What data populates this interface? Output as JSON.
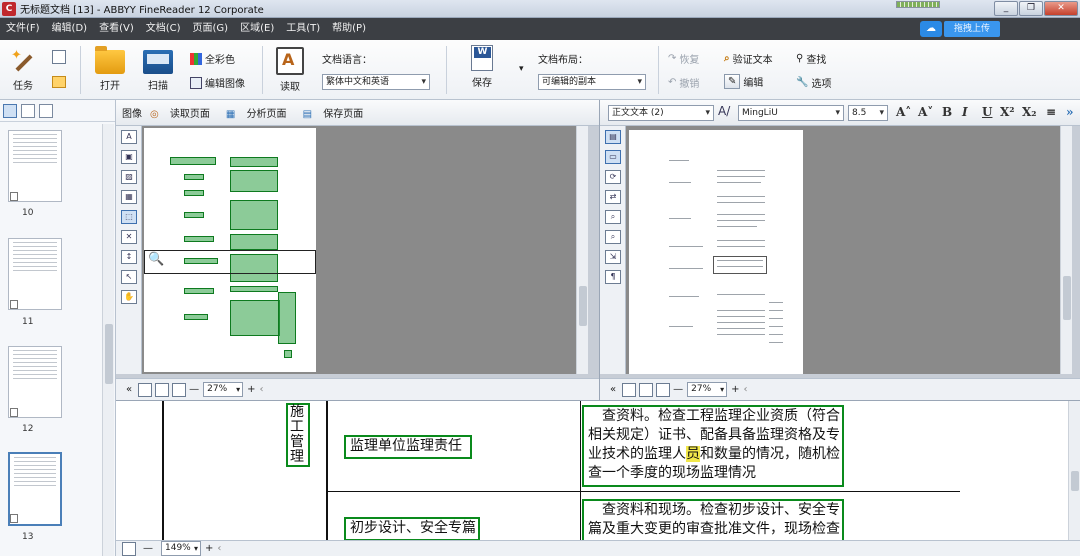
{
  "window": {
    "title": "无标题文档 [13] - ABBYY FineReader 12 Corporate",
    "controls": [
      "_",
      "❐",
      "✕"
    ]
  },
  "menu": {
    "items": [
      "文件(F)",
      "编辑(D)",
      "查看(V)",
      "文档(C)",
      "页面(G)",
      "区域(E)",
      "工具(T)",
      "帮助(P)"
    ],
    "upload_label": "拖拽上传"
  },
  "toolbar": {
    "task_label": "任务",
    "open_label": "打开",
    "scan_label": "扫描",
    "color_label": "全彩色",
    "edit_image_label": "编辑图像",
    "read_label": "读取",
    "doc_language_label": "文档语言：",
    "doc_language_value": "繁体中文和英语",
    "save_label": "保存",
    "doc_layout_label": "文档布局：",
    "doc_layout_value": "可编辑的副本",
    "redo_label": "恢复",
    "undo_label": "撤销",
    "verify_label": "验证文本",
    "find_label": "查找",
    "edit_label": "编辑",
    "options_label": "选项"
  },
  "thumbnails": {
    "pages": [
      "10",
      "11",
      "12",
      "13"
    ],
    "selected": "13"
  },
  "image_pane": {
    "title": "图像",
    "read_page": "读取页面",
    "analyze_page": "分析页面",
    "save_page": "保存页面",
    "zoom": "27%"
  },
  "text_pane": {
    "style_value": "正文文本 (2)",
    "font_value": "MingLiU",
    "size_value": "8.5",
    "format_buttons": [
      "A˄",
      "A˅",
      "B",
      "I",
      "U",
      "X²",
      "X₂",
      "≡",
      "»"
    ],
    "zoom": "27%"
  },
  "zoom_pane": {
    "vertical_label": [
      "施",
      "工",
      "管",
      "理"
    ],
    "row1_cell": "监理单位监理责任",
    "row1_text_a": "查资料。检查工程监理企业资质（符合",
    "row1_text_b": "相关规定）证书、配备具备监理资格及专",
    "row1_text_c_pre": "业技术的监理人",
    "row1_text_c_hl": "员",
    "row1_text_c_post": "和数量的情况，随机检",
    "row1_text_d": "查一个季度的现场监理情况",
    "row2_cell": "初步设计、安全专篇",
    "row2_text_a": "查资料和现场。检查初步设计、安全专",
    "row2_text_b": "篇及重大变更的审查批准文件，现场检查"
  },
  "statusbar": {
    "zoom": "149%"
  }
}
